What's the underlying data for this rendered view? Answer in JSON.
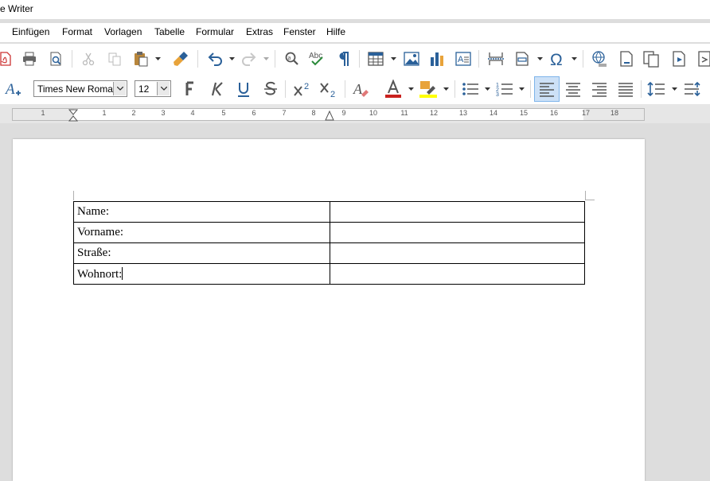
{
  "window": {
    "title": "e Writer"
  },
  "menu": [
    "Einfügen",
    "Format",
    "Vorlagen",
    "Tabelle",
    "Formular",
    "Extras",
    "Fenster",
    "Hilfe"
  ],
  "formatting": {
    "font_name": "Times New Roman",
    "font_size": "12"
  },
  "ruler": {
    "numbers": [
      "1",
      "1",
      "2",
      "3",
      "4",
      "5",
      "6",
      "7",
      "8",
      "9",
      "10",
      "11",
      "12",
      "13",
      "14",
      "15",
      "16",
      "17",
      "18"
    ]
  },
  "document": {
    "table": [
      [
        "Name:",
        ""
      ],
      [
        "Vorname:",
        ""
      ],
      [
        "Straße:",
        ""
      ],
      [
        "Wohnort:",
        ""
      ]
    ]
  },
  "colors": {
    "font_color": "#c9211e",
    "highlight_color": "#ffff00",
    "accent": "#2a6099",
    "active_button_bg": "#cde1f7"
  },
  "icons": [
    "export-pdf-icon",
    "print-icon",
    "print-preview-icon",
    "cut-icon",
    "copy-icon",
    "paste-icon",
    "clone-formatting-icon",
    "undo-icon",
    "redo-icon",
    "find-replace-icon",
    "spelling-icon",
    "formatting-marks-icon",
    "insert-table-icon",
    "insert-image-icon",
    "insert-chart-icon",
    "insert-textbox-icon",
    "page-break-icon",
    "insert-field-icon",
    "special-character-icon",
    "hyperlink-icon",
    "footnote-icon",
    "comment-icon",
    "track-changes-icon"
  ]
}
